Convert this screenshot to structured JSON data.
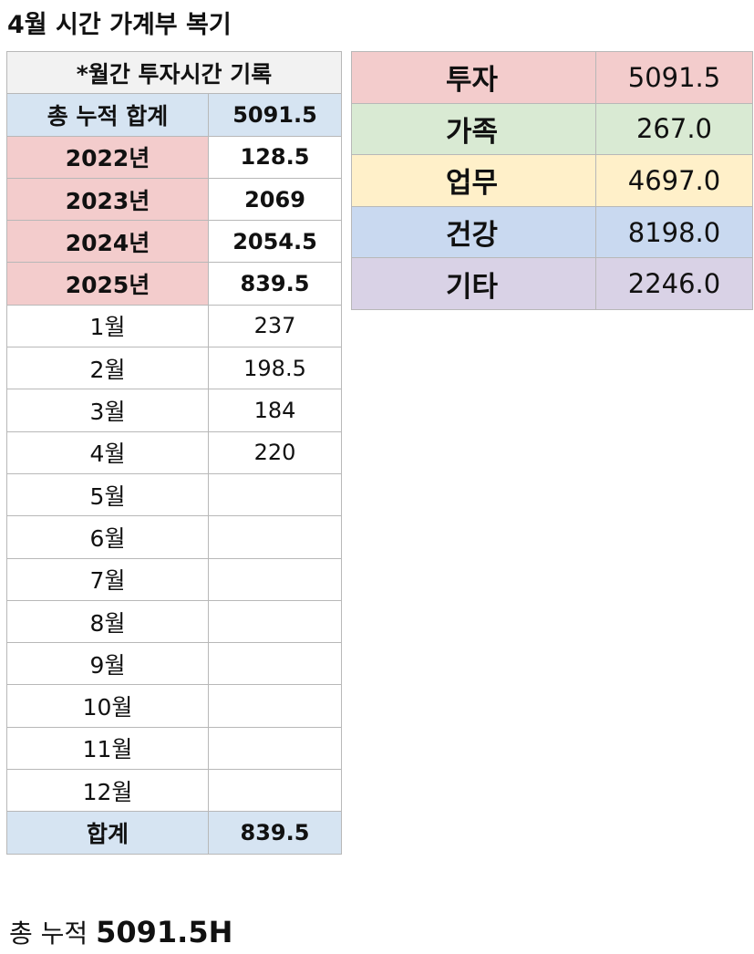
{
  "title": "4월 시간 가계부 복기",
  "monthly": {
    "header": "*월간 투자시간 기록",
    "cumulative": {
      "label": "총 누적 합계",
      "value": "5091.5",
      "color": "#d6e4f2"
    },
    "years": [
      {
        "label": "2022년",
        "value": "128.5"
      },
      {
        "label": "2023년",
        "value": "2069"
      },
      {
        "label": "2024년",
        "value": "2054.5"
      },
      {
        "label": "2025년",
        "value": "839.5"
      }
    ],
    "year_color": "#f3cccc",
    "months": [
      {
        "label": "1월",
        "value": "237"
      },
      {
        "label": "2월",
        "value": "198.5"
      },
      {
        "label": "3월",
        "value": "184"
      },
      {
        "label": "4월",
        "value": "220"
      },
      {
        "label": "5월",
        "value": ""
      },
      {
        "label": "6월",
        "value": ""
      },
      {
        "label": "7월",
        "value": ""
      },
      {
        "label": "8월",
        "value": ""
      },
      {
        "label": "9월",
        "value": ""
      },
      {
        "label": "10월",
        "value": ""
      },
      {
        "label": "11월",
        "value": ""
      },
      {
        "label": "12월",
        "value": ""
      }
    ],
    "sum": {
      "label": "합계",
      "value": "839.5"
    }
  },
  "categories": [
    {
      "name": "투자",
      "value": "5091.5",
      "color": "#f3cccc"
    },
    {
      "name": "가족",
      "value": "267.0",
      "color": "#d9ead3"
    },
    {
      "name": "업무",
      "value": "4697.0",
      "color": "#fff0c9"
    },
    {
      "name": "건강",
      "value": "8198.0",
      "color": "#c9d9f0"
    },
    {
      "name": "기타",
      "value": "2246.0",
      "color": "#d9d2e6"
    }
  ],
  "footer": {
    "prefix": "총 누적 ",
    "value": "5091.5H"
  }
}
